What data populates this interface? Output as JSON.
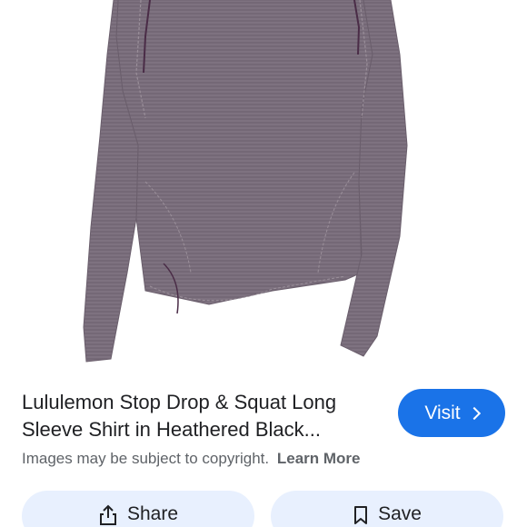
{
  "result": {
    "title": "Lululemon Stop Drop & Squat Long Sleeve Shirt in Heathered Black...",
    "image_alt": "gray-long-sleeve-shirt"
  },
  "visit_button": {
    "label": "Visit",
    "accent_color": "#1a73e8"
  },
  "notice": {
    "text": "Images may be subject to copyright.",
    "link": "Learn More"
  },
  "actions": {
    "share_label": "Share",
    "share_icon": "share-icon",
    "save_label": "Save",
    "save_icon": "bookmark-icon",
    "button_color": "#e8f0fe"
  }
}
